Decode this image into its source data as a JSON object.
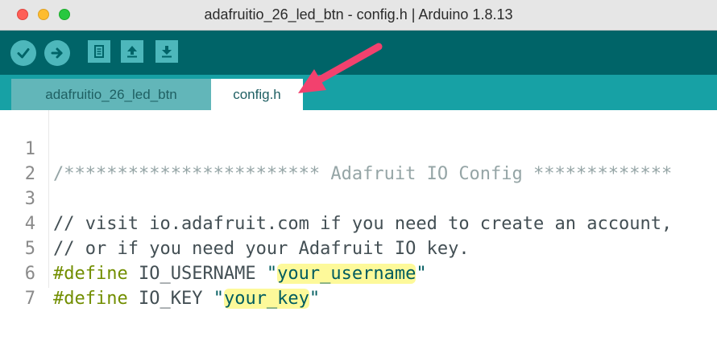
{
  "window": {
    "title": "adafruitio_26_led_btn - config.h | Arduino 1.8.13"
  },
  "toolbar": {
    "buttons": [
      {
        "name": "verify",
        "icon": "check-icon"
      },
      {
        "name": "upload",
        "icon": "arrow-right-icon"
      },
      {
        "name": "new",
        "icon": "new-file-icon"
      },
      {
        "name": "open",
        "icon": "arrow-up-icon"
      },
      {
        "name": "save",
        "icon": "arrow-down-icon"
      }
    ]
  },
  "tabs": [
    {
      "label": "adafruitio_26_led_btn",
      "active": false
    },
    {
      "label": "config.h",
      "active": true
    }
  ],
  "editor": {
    "lines": [
      {
        "number": "1",
        "text": "/************************ Adafruit IO Config *************"
      },
      {
        "number": "2",
        "text": ""
      },
      {
        "number": "3",
        "text": "// visit io.adafruit.com if you need to create an account,"
      },
      {
        "number": "4",
        "text": "// or if you need your Adafruit IO key."
      },
      {
        "number": "5",
        "directive": "#define",
        "name": "IO_USERNAME",
        "value": "your_username"
      },
      {
        "number": "6",
        "directive": "#define",
        "name": "IO_KEY",
        "value": "your_key"
      },
      {
        "number": "7",
        "text": ""
      }
    ]
  },
  "colors": {
    "toolbar": "#006468",
    "tabbar": "#17a1a5",
    "button": "#4db7bb",
    "keyword": "#728e00",
    "highlight": "#fdf99a",
    "annotation_arrow": "#f2416e"
  }
}
